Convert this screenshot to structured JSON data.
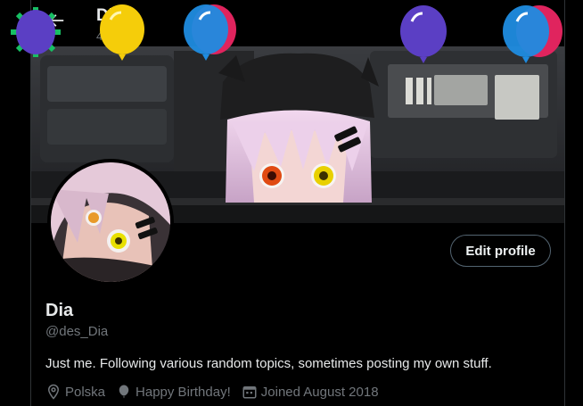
{
  "header": {
    "back_icon": "arrow-left-icon",
    "title": "Dia",
    "post_count": "4,1 posts"
  },
  "profile": {
    "name": "Dia",
    "handle": "@des_Dia",
    "bio": "Just me. Following various random topics, sometimes posting my own stuff.",
    "edit_button": "Edit profile",
    "location": "Polska",
    "birthday": "Happy Birthday!",
    "joined": "Joined August 2018"
  },
  "icons": {
    "location": "location-pin-icon",
    "birthday": "balloon-icon",
    "joined": "calendar-icon"
  },
  "colors": {
    "background": "#000000",
    "text_primary": "#e7e9ea",
    "text_secondary": "#71767b",
    "border": "#2f3336",
    "balloon_purple": "#5b3fc4",
    "balloon_yellow": "#f5cd0a",
    "balloon_blue": "#1f8ce0",
    "balloon_pink": "#e0245e",
    "confetti_green": "#17bf63"
  }
}
